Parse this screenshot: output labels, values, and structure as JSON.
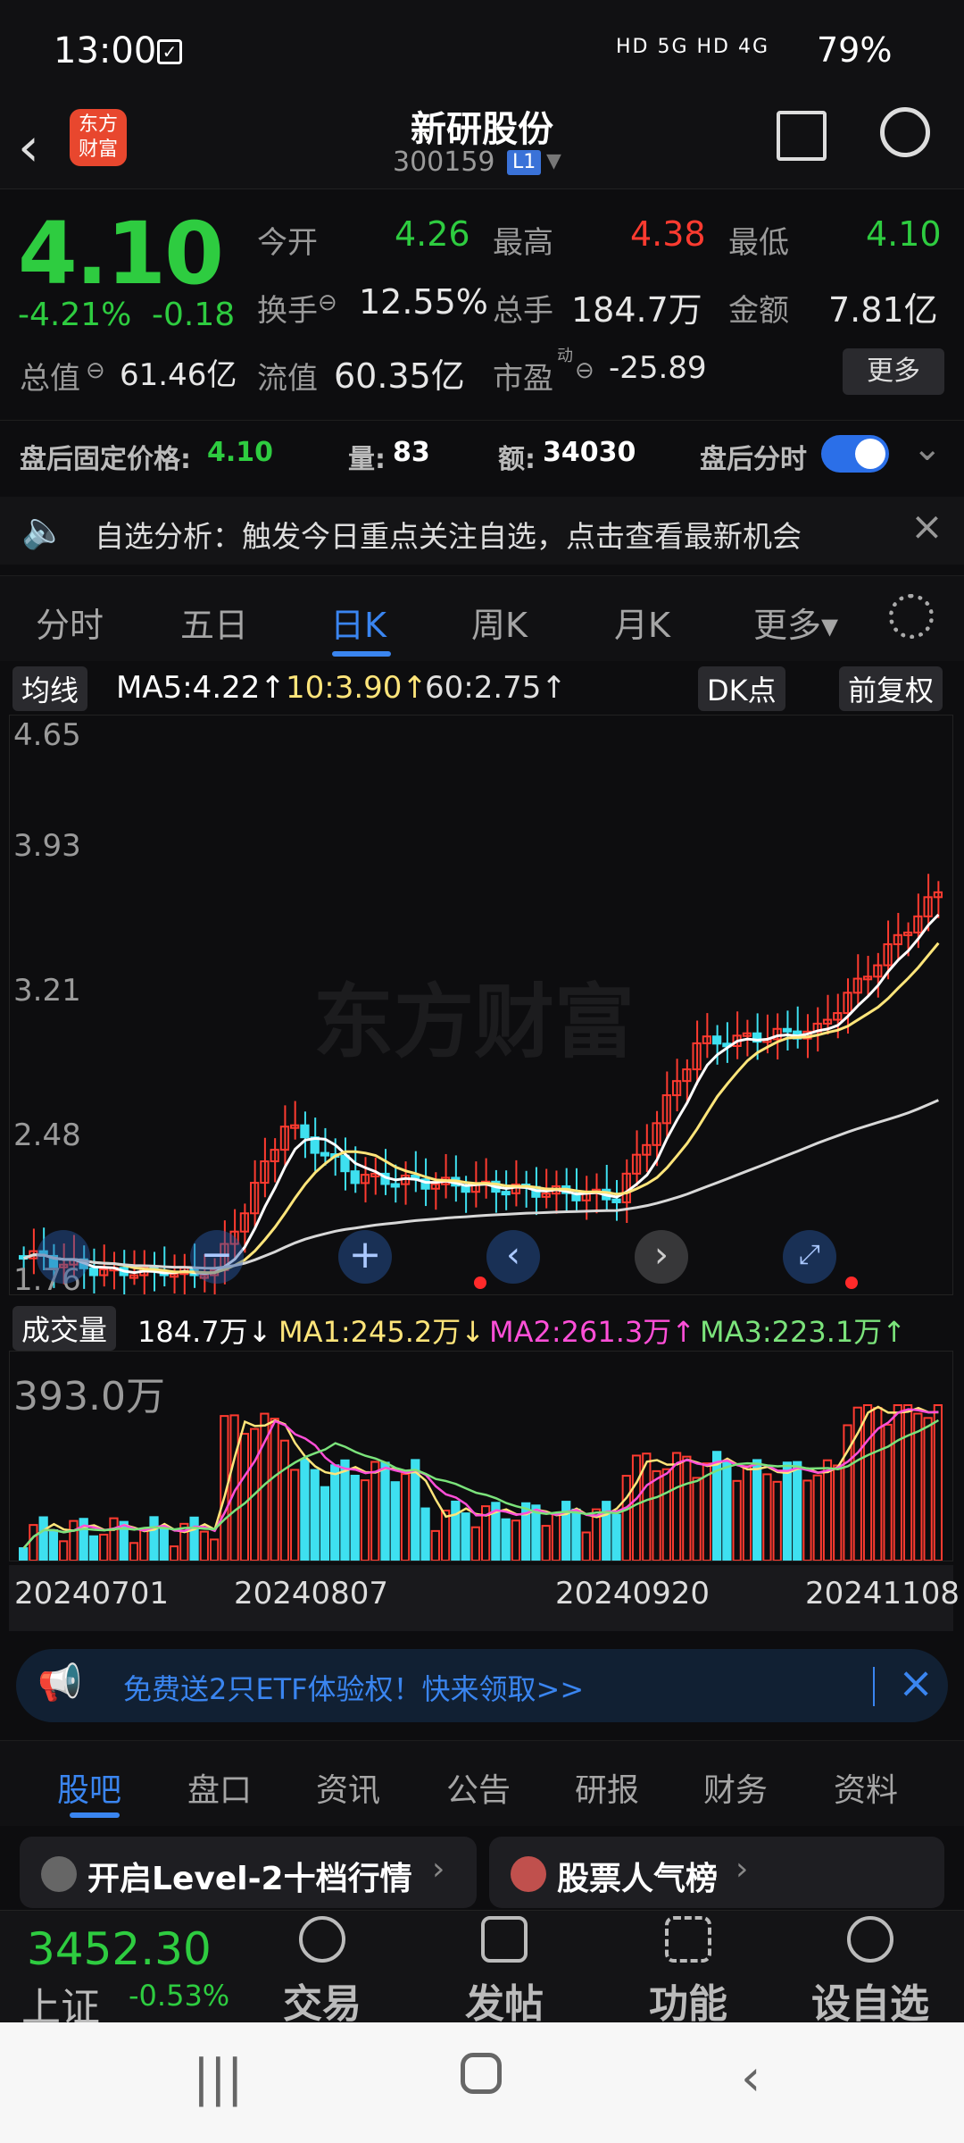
{
  "status": {
    "time": "13:00",
    "signal": "HD 5G HD 4G",
    "battery": "79%"
  },
  "header": {
    "logo": "东方财富",
    "name": "新研股份",
    "code": "300159",
    "level": "L1"
  },
  "quote": {
    "price": "4.10",
    "pct": "-4.21%",
    "chg": "-0.18",
    "open_lbl": "今开",
    "open": "4.26",
    "high_lbl": "最高",
    "high": "4.38",
    "low_lbl": "最低",
    "low": "4.10",
    "turnover_lbl": "换手",
    "turnover": "12.55%",
    "volume_lbl": "总手",
    "volume": "184.7万",
    "amount_lbl": "金额",
    "amount": "7.81亿",
    "mcap_lbl": "总值",
    "mcap": "61.46亿",
    "float_lbl": "流值",
    "float": "60.35亿",
    "pe_lbl": "市盈",
    "pe_sup": "动",
    "pe": "-25.89",
    "more": "更多"
  },
  "afterhours": {
    "price_lbl": "盘后固定价格:",
    "price": "4.10",
    "vol_lbl": "量:",
    "vol": "83",
    "amt_lbl": "额:",
    "amt": "34030",
    "toggle_lbl": "盘后分时"
  },
  "notice": {
    "text": "自选分析：触发今日重点关注自选，点击查看最新机会"
  },
  "tabs": [
    "分时",
    "五日",
    "日K",
    "周K",
    "月K",
    "更多▾"
  ],
  "ma": {
    "selector": "均线",
    "ma5": "MA5:4.22↑",
    "ma10": "10:3.90↑",
    "ma60": "60:2.75↑",
    "dk": "DK点",
    "fq": "前复权"
  },
  "kchart": {
    "watermark": "东方财富",
    "yticks": [
      "4.65",
      "3.93",
      "3.21",
      "2.48",
      "1.76"
    ]
  },
  "vol": {
    "selector": "成交量",
    "cur": "184.7万↓",
    "ma1": "MA1:245.2万↓",
    "ma2": "MA2:261.3万↑",
    "ma3": "MA3:223.1万↑",
    "ymax": "393.0万"
  },
  "dates": [
    "20240701",
    "20240807",
    "20240920",
    "20241108"
  ],
  "promo": {
    "text": "免费送2只ETF体验权！快来领取>>"
  },
  "ftabs": [
    "股吧",
    "盘口",
    "资讯",
    "公告",
    "研报",
    "财务",
    "资料"
  ],
  "cards": [
    "开启Level-2十档行情",
    "股票人气榜"
  ],
  "index": {
    "value": "3452.30",
    "name": "上证",
    "chg": "-0.53%"
  },
  "actions": [
    "交易",
    "发帖",
    "功能",
    "设自选"
  ],
  "colors": {
    "up": "#ff3b30",
    "down": "#2ecc40",
    "accent": "#3a85f0",
    "ma5": "#ffffff",
    "ma10": "#ffe57a",
    "ma60": "#d0d0d0"
  }
}
